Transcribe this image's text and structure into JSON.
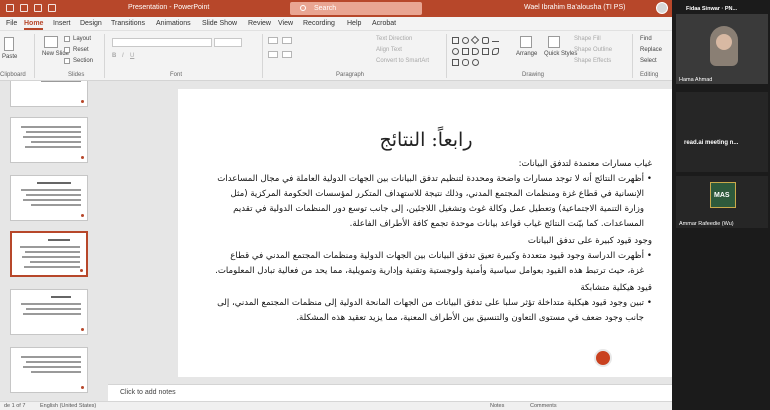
{
  "window": {
    "title": "Presentation - PowerPoint",
    "search_placeholder": "Search",
    "user": "Wael Ibrahim Ba'alousha (TI PS)"
  },
  "menu": {
    "tabs": [
      "File",
      "Home",
      "Insert",
      "Design",
      "Transitions",
      "Animations",
      "Slide Show",
      "Review",
      "View",
      "Recording",
      "Help",
      "Acrobat"
    ],
    "active": "Home"
  },
  "ribbon": {
    "paste": "Paste",
    "new_slide": "New Slide",
    "layout": "Layout",
    "reset": "Reset",
    "section": "Section",
    "text_direction": "Text Direction",
    "align_text": "Align Text",
    "convert_smartart": "Convert to SmartArt",
    "arrange": "Arrange",
    "quick_styles": "Quick Styles",
    "shape_fill": "Shape Fill",
    "shape_outline": "Shape Outline",
    "shape_effects": "Shape Effects",
    "find": "Find",
    "replace": "Replace",
    "select": "Select",
    "groups": {
      "clipboard": "Clipboard",
      "slides": "Slides",
      "font": "Font",
      "paragraph": "Paragraph",
      "drawing": "Drawing",
      "editing": "Editing"
    }
  },
  "slide": {
    "title": "رابعاً: النتائج",
    "heading1": "غياب مسارات معتمدة لتدفق البيانات:",
    "bullet1": "أظهرت النتائج أنه لا توجد مسارات واضحة ومحددة لتنظيم تدفق البيانات بين الجهات الدولية العاملة في مجال المساعدات الإنسانية في قطاع غزة ومنظمات المجتمع المدني، وذلك نتيجة للاستهداف المتكرر لمؤسسات الحكومة المركزية (مثل وزارة التنمية الاجتماعية) وتعطيل عمل وكالة غوث وتشغيل اللاجئين، إلى جانب توسع دور المنظمات الدولية في تقديم المساعدات. كما بيّنت النتائج غياب قواعد بيانات موحدة تجمع كافة الأطراف الفاعلة.",
    "heading2": "وجود قيود كبيرة على تدفق البيانات",
    "bullet2": "أظهرت الدراسة وجود قيود متعددة وكبيرة تعيق تدفق البيانات بين الجهات الدولية ومنظمات المجتمع المدني في قطاع غزة، حيث ترتبط هذه القيود بعوامل سياسية وأمنية ولوجستية وتقنية وإدارية وتمويلية، مما يحد من فعالية تبادل المعلومات.",
    "heading3": "قيود هيكلية متشابكة",
    "bullet3": "تبين وجود قيود هيكلية متداخلة تؤثر سلبا على تدفق البيانات من الجهات المانحة الدولية إلى منظمات المجتمع المدني، إلى جانب وجود ضعف في مستوى التعاون والتنسيق بين الأطراف المعنية، مما يزيد تعقيد هذه المشكلة."
  },
  "notes_placeholder": "Click to add notes",
  "status": {
    "slide_count": "de 1 of 7",
    "language": "English (United States)",
    "notes": "Notes",
    "comments": "Comments"
  },
  "meeting": {
    "participant1": "Fidaa Sinwar · PN...",
    "participant2": "Hama Ahmad",
    "participant3": "read.ai meeting n...",
    "participant4": "Ammar Rafeedie (Wu)",
    "logo_text": "MAS"
  }
}
